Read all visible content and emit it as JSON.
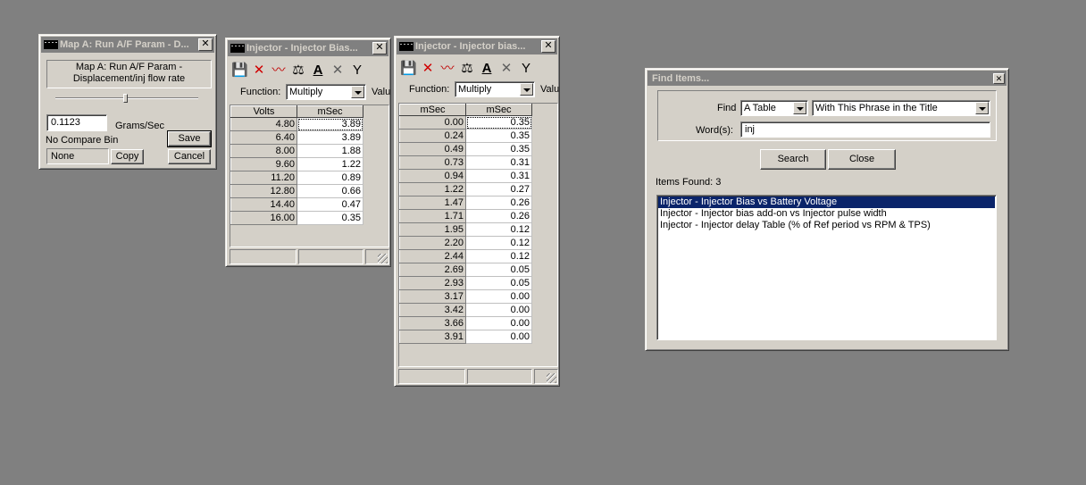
{
  "map_window": {
    "title": "Map A: Run A/F Param - D...",
    "description": "Map A: Run A/F Param - Displacement/inj flow rate",
    "value": "0.1123",
    "unit": "Grams/Sec",
    "compare_label": "No Compare Bin",
    "compare_value": "None",
    "save": "Save",
    "copy": "Copy",
    "cancel": "Cancel"
  },
  "table1": {
    "title": "Injector - Injector Bias...",
    "function_label": "Function:",
    "function_value": "Multiply",
    "value_label": "Valu",
    "col_x": "Volts",
    "col_y": "mSec",
    "rows": [
      [
        "4.80",
        "3.89"
      ],
      [
        "6.40",
        "3.89"
      ],
      [
        "8.00",
        "1.88"
      ],
      [
        "9.60",
        "1.22"
      ],
      [
        "11.20",
        "0.89"
      ],
      [
        "12.80",
        "0.66"
      ],
      [
        "14.40",
        "0.47"
      ],
      [
        "16.00",
        "0.35"
      ]
    ]
  },
  "table2": {
    "title": "Injector - Injector bias...",
    "function_label": "Function:",
    "function_value": "Multiply",
    "value_label": "Valu",
    "col_x": "mSec",
    "col_y": "mSec",
    "rows": [
      [
        "0.00",
        "0.35"
      ],
      [
        "0.24",
        "0.35"
      ],
      [
        "0.49",
        "0.35"
      ],
      [
        "0.73",
        "0.31"
      ],
      [
        "0.94",
        "0.31"
      ],
      [
        "1.22",
        "0.27"
      ],
      [
        "1.47",
        "0.26"
      ],
      [
        "1.71",
        "0.26"
      ],
      [
        "1.95",
        "0.12"
      ],
      [
        "2.20",
        "0.12"
      ],
      [
        "2.44",
        "0.12"
      ],
      [
        "2.69",
        "0.05"
      ],
      [
        "2.93",
        "0.05"
      ],
      [
        "3.17",
        "0.00"
      ],
      [
        "3.42",
        "0.00"
      ],
      [
        "3.66",
        "0.00"
      ],
      [
        "3.91",
        "0.00"
      ]
    ]
  },
  "find": {
    "title": "Find Items...",
    "find_label": "Find",
    "type_value": "A Table",
    "mode_value": "With This Phrase in the Title",
    "words_label": "Word(s):",
    "words_value": "inj",
    "search": "Search",
    "close": "Close",
    "items_found": "Items Found: 3",
    "results": [
      "Injector - Injector Bias vs Battery Voltage",
      "Injector - Injector bias add-on vs Injector pulse width",
      "Injector - Injector delay Table (% of Ref period vs RPM & TPS)"
    ]
  }
}
